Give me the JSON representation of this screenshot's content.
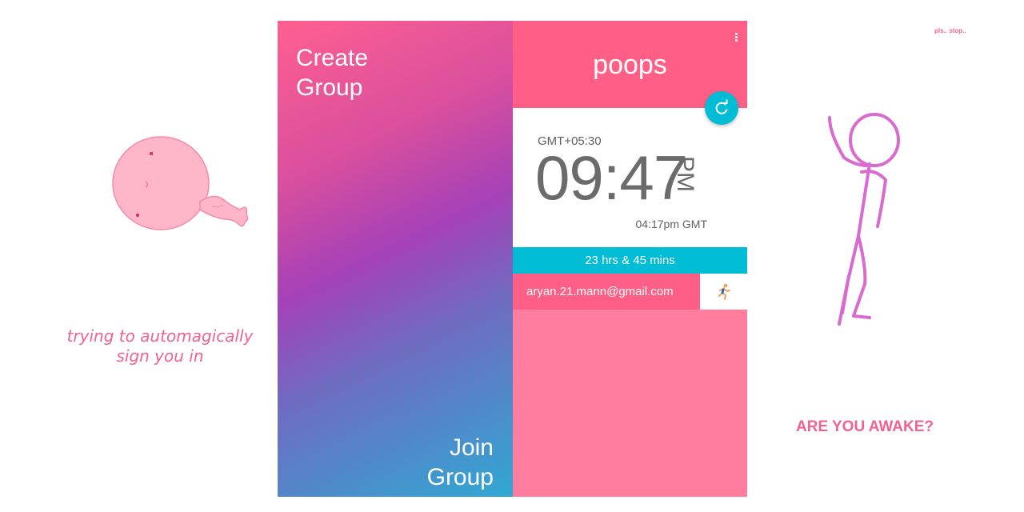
{
  "left_panel": {
    "caption_line1": "trying to automagically",
    "caption_line2": "sign you in",
    "accent_color": "#f06292"
  },
  "gradient_screen": {
    "create_line1": "Create",
    "create_line2": "Group",
    "join_line1": "Join",
    "join_line2": "Group",
    "gradient_colors": [
      "#ff5f8f",
      "#a541b8",
      "#2fa8d4"
    ]
  },
  "group_screen": {
    "group_name": "poops",
    "menu_icon": "more-vert-icon",
    "refresh_icon": "refresh-icon",
    "clock": {
      "timezone": "GMT+05:30",
      "time": "09:47",
      "ampm": "PM",
      "gmt_time": "04:17pm GMT"
    },
    "countdown": "23 hrs & 45 mins",
    "members": [
      {
        "email": "aryan.21.mann@gmail.com",
        "action_icon": "🏃"
      }
    ],
    "colors": {
      "header": "#ff5f87",
      "background": "#ff7d9f",
      "accent": "#00bcd4"
    }
  },
  "right_panel": {
    "tiny_caption": "pls.. stop..",
    "heading": "ARE YOU AWAKE?"
  }
}
